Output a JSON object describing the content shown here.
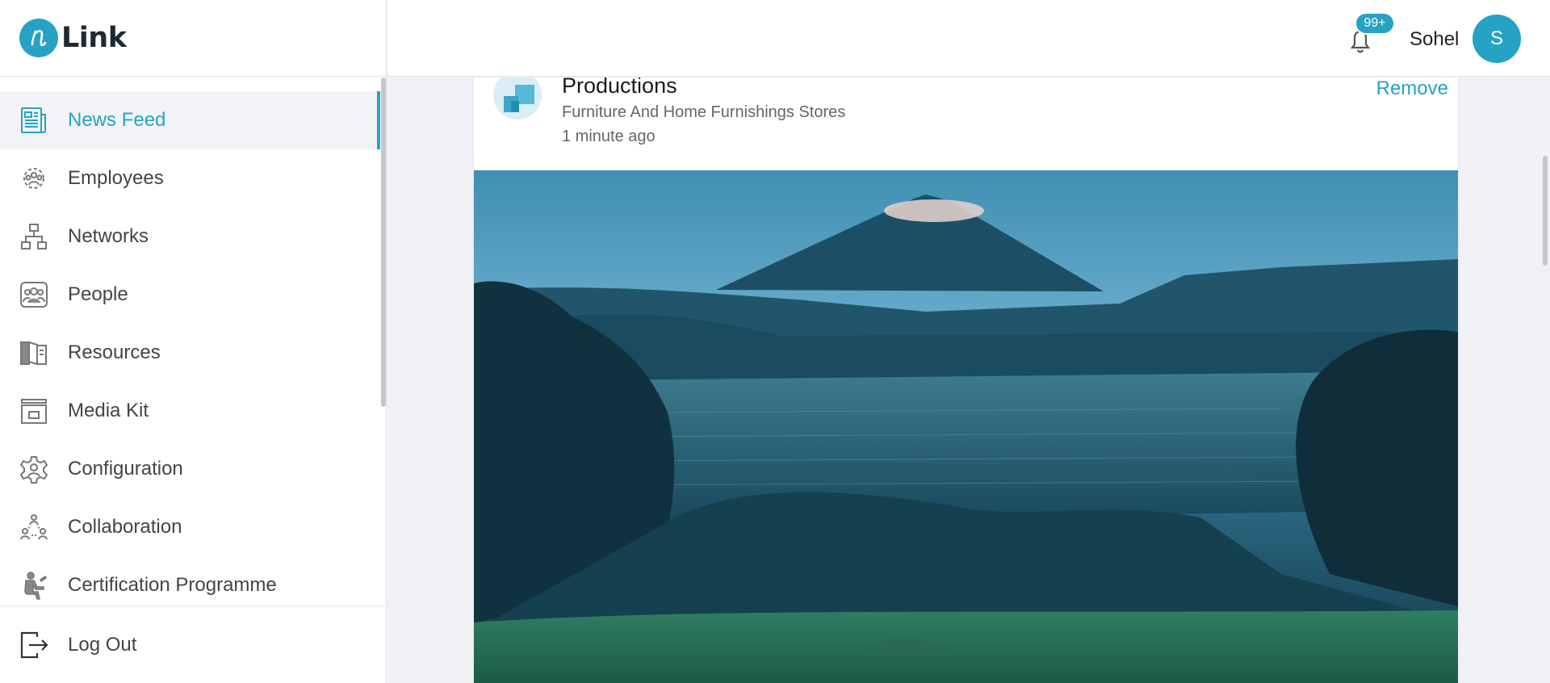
{
  "app": {
    "logo_text": "Link"
  },
  "sidebar": {
    "items": [
      {
        "label": "News Feed",
        "icon": "newspaper-icon",
        "active": true
      },
      {
        "label": "Employees",
        "icon": "employees-gear-icon",
        "active": false
      },
      {
        "label": "Networks",
        "icon": "network-icon",
        "active": false
      },
      {
        "label": "People",
        "icon": "people-icon",
        "active": false
      },
      {
        "label": "Resources",
        "icon": "book-icon",
        "active": false
      },
      {
        "label": "Media Kit",
        "icon": "media-kit-icon",
        "active": false
      },
      {
        "label": "Configuration",
        "icon": "gear-icon",
        "active": false
      },
      {
        "label": "Collaboration",
        "icon": "collaboration-icon",
        "active": false
      },
      {
        "label": "Certification Programme",
        "icon": "certification-icon",
        "active": false
      }
    ],
    "logout_label": "Log Out"
  },
  "header": {
    "notification_badge": "99+",
    "user_name": "Sohel",
    "avatar_initial": "S"
  },
  "post": {
    "org_name": "Productions",
    "org_category": "Furniture And Home Furnishings Stores",
    "time_ago": "1 minute ago",
    "remove_label": "Remove"
  },
  "colors": {
    "accent": "#26a3c4",
    "sidebar_active_bg": "#f2f3f7",
    "page_bg": "#f0f1f4"
  }
}
